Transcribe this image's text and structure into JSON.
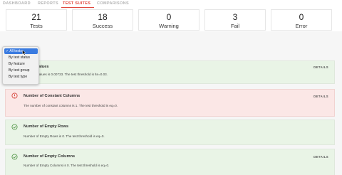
{
  "tabs": [
    {
      "label": "DASHBOARD",
      "active": false
    },
    {
      "label": "REPORTS",
      "active": false
    },
    {
      "label": "TEST SUITES",
      "active": true
    },
    {
      "label": "COMPARISONS",
      "active": false
    }
  ],
  "summary": [
    {
      "value": "21",
      "label": "Tests"
    },
    {
      "value": "18",
      "label": "Success"
    },
    {
      "value": "0",
      "label": "Warning"
    },
    {
      "value": "3",
      "label": "Fail"
    },
    {
      "value": "0",
      "label": "Error"
    }
  ],
  "filter_menu": {
    "options": [
      "All tests",
      "By test status",
      "By feature",
      "By test group",
      "By test type"
    ],
    "selected_index": 0
  },
  "tests": [
    {
      "title": "issing Values",
      "description": "f missing values is 0.00733. The test threshold is lte=0.03.",
      "status": "success",
      "details": "DETAILS"
    },
    {
      "title": "Number of Constant Columns",
      "description": "The number of constant columns is 1. The test threshold is eq=0.",
      "status": "fail",
      "details": "DETAILS"
    },
    {
      "title": "Number of Empty Rows",
      "description": "Number of Empty Rows is 0. The test threshold is eq=0.",
      "status": "success",
      "details": ""
    },
    {
      "title": "Number of Empty Columns",
      "description": "Number of Empty Columns is 0. The test threshold is eq=0.",
      "status": "success",
      "details": "DETAILS"
    }
  ],
  "colors": {
    "accent": "#e0463c",
    "success_bg": "#e9f4e6",
    "fail_bg": "#fbe7e6",
    "menu_selected": "#3a7be0"
  },
  "icons": {
    "success": "check-circle-icon",
    "fail": "alert-circle-icon"
  }
}
